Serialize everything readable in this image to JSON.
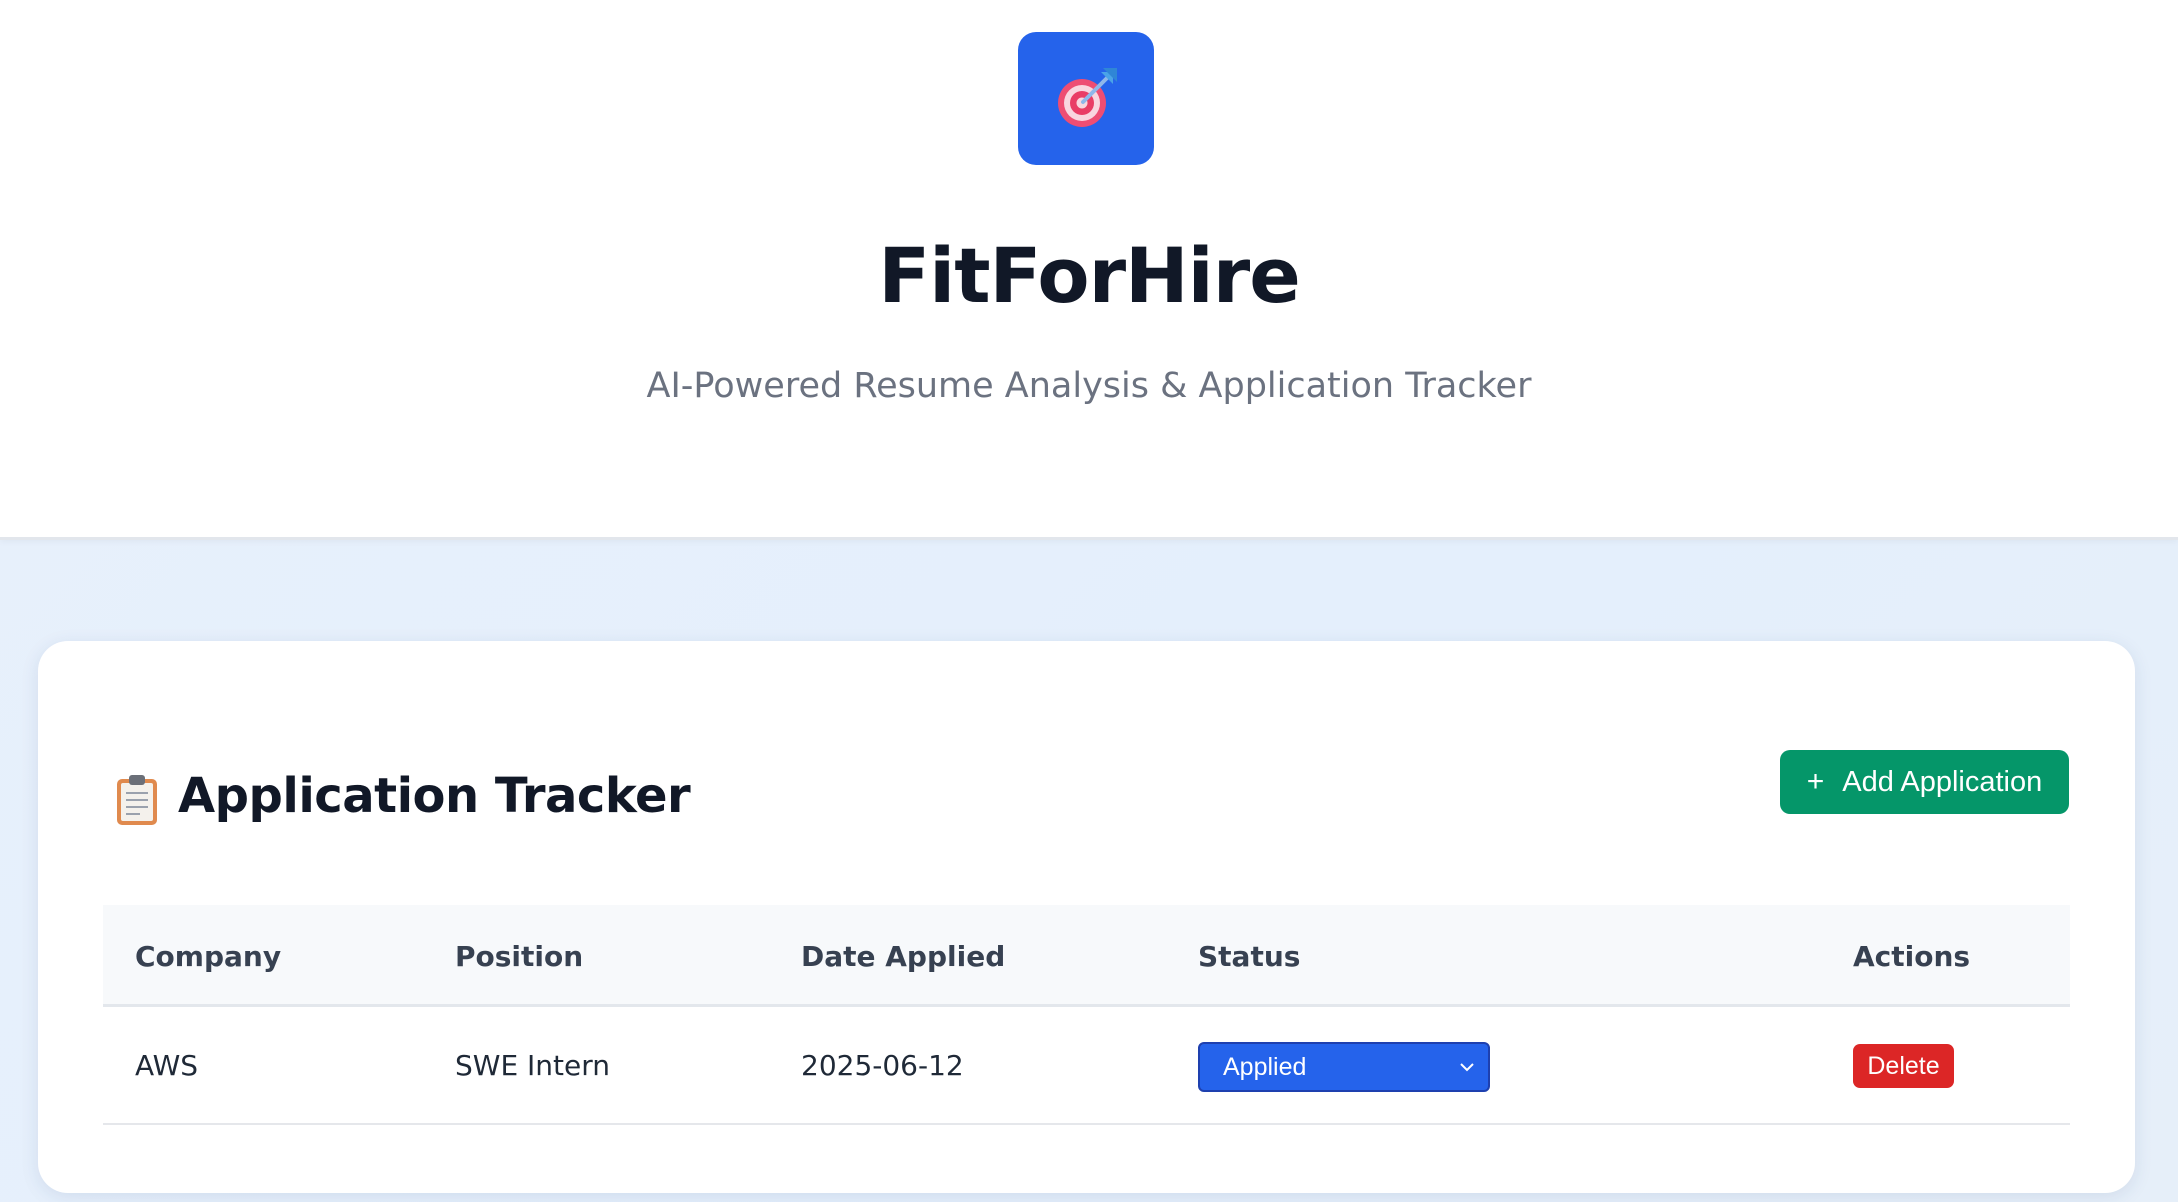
{
  "header": {
    "logo_icon": "target-dart-icon",
    "title": "FitForHire",
    "subtitle": "AI-Powered Resume Analysis & Application Tracker"
  },
  "tracker": {
    "title_icon": "clipboard-icon",
    "title": "Application Tracker",
    "add_button": {
      "icon": "+",
      "label": "Add Application"
    },
    "columns": [
      "Company",
      "Position",
      "Date Applied",
      "Status",
      "Actions"
    ],
    "rows": [
      {
        "company": "AWS",
        "position": "SWE Intern",
        "date_applied": "2025-06-12",
        "status": "Applied",
        "action_label": "Delete"
      }
    ]
  },
  "colors": {
    "brand_blue": "#2563eb",
    "add_green": "#059669",
    "delete_red": "#dc2626"
  }
}
